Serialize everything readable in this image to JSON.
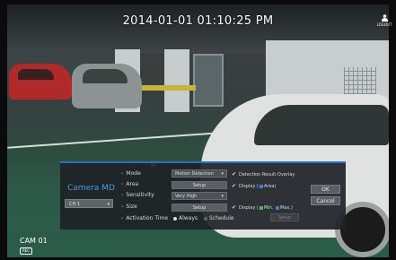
{
  "header": {
    "timestamp": "2014-01-01 01:10:25 PM",
    "logout_label": "LOGOUT"
  },
  "camera": {
    "name": "CAM 01",
    "rec_badge": "REC"
  },
  "dialog": {
    "title": "Camera MD",
    "channel_select": "CH 1",
    "rows": {
      "mode_label": "Mode",
      "mode_value": "Motion Detection",
      "area_label": "Area",
      "area_button": "Setup",
      "sensitivity_label": "Sensitivity",
      "sensitivity_value": "Very High",
      "size_label": "Size",
      "size_button": "Setup",
      "activation_label": "Activation Time",
      "activation_always": "Always",
      "activation_schedule": "Schedule"
    },
    "overlay": {
      "result_overlay": "Detection Result Overlay",
      "display_area_prefix": "Display (",
      "display_area_suffix": "Area)",
      "display_size_prefix": "Display (",
      "display_size_min": "Min.",
      "display_size_max": "Max.)",
      "setup_disabled": "Setup"
    },
    "buttons": {
      "ok": "OK",
      "cancel": "Cancel"
    }
  },
  "colors": {
    "accent": "#2f6fbf",
    "title": "#4a9ae8",
    "area_chip": "#3f7fd6",
    "min_chip": "#3fbf4f",
    "max_chip": "#3f7fd6",
    "radio_on": "#dcdcdc"
  }
}
